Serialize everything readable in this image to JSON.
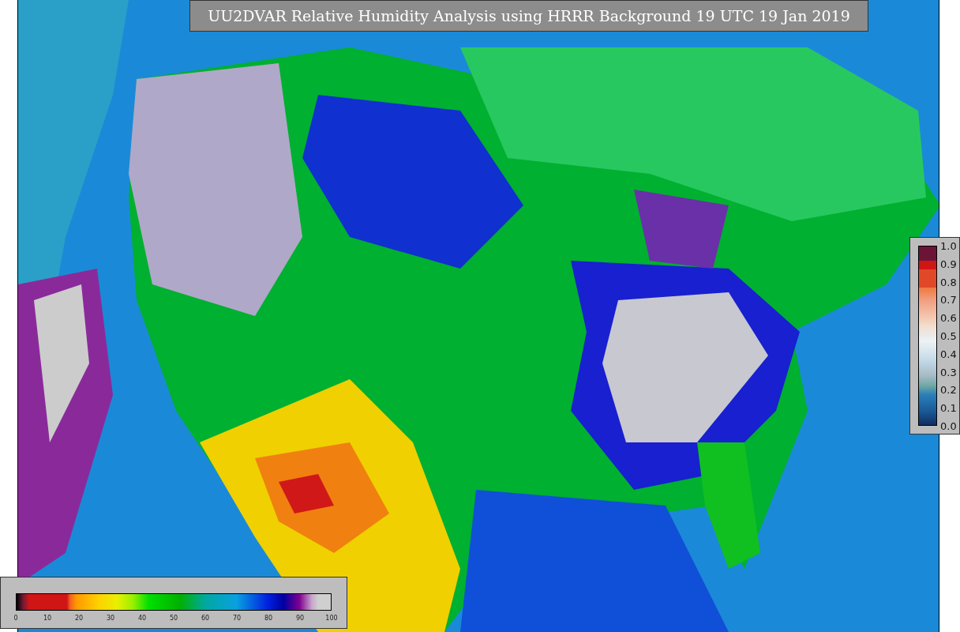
{
  "title": "UU2DVAR Relative Humidity Analysis using HRRR Background 19 UTC 19 Jan 2019",
  "humidity_colorbar": {
    "ticks": [
      "0",
      "10",
      "20",
      "30",
      "40",
      "50",
      "60",
      "70",
      "80",
      "90",
      "100"
    ]
  },
  "observation_colorbar": {
    "ticks": [
      "1.0",
      "0.9",
      "0.8",
      "0.7",
      "0.6",
      "0.5",
      "0.4",
      "0.3",
      "0.2",
      "0.1",
      "0.0"
    ]
  }
}
